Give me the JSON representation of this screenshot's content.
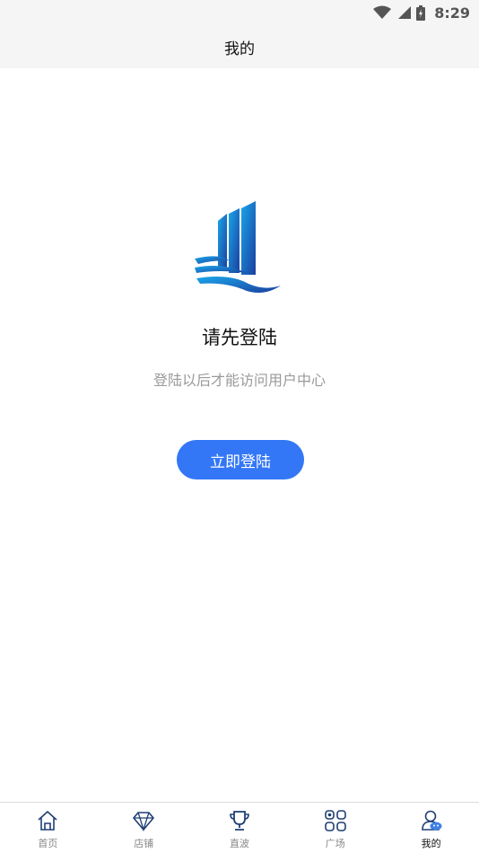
{
  "status_bar": {
    "time": "8:29",
    "icons": [
      "wifi-icon",
      "signal-icon",
      "battery-icon"
    ]
  },
  "header": {
    "title": "我的"
  },
  "main": {
    "logo": "city-waves-logo",
    "title": "请先登陆",
    "subtitle": "登陆以后才能访问用户中心",
    "login_button": "立即登陆"
  },
  "tab_bar": {
    "tabs": [
      {
        "label": "首页",
        "icon": "home-icon",
        "active": false
      },
      {
        "label": "店铺",
        "icon": "diamond-icon",
        "active": false
      },
      {
        "label": "直波",
        "icon": "trophy-icon",
        "active": false
      },
      {
        "label": "广场",
        "icon": "grid-icon",
        "active": false
      },
      {
        "label": "我的",
        "icon": "profile-icon",
        "active": true
      }
    ]
  },
  "colors": {
    "accent": "#3377f6",
    "header_bg": "#f5f5f5",
    "icon_navy": "#1f3f74",
    "subtitle_text": "#9a9a9a"
  }
}
